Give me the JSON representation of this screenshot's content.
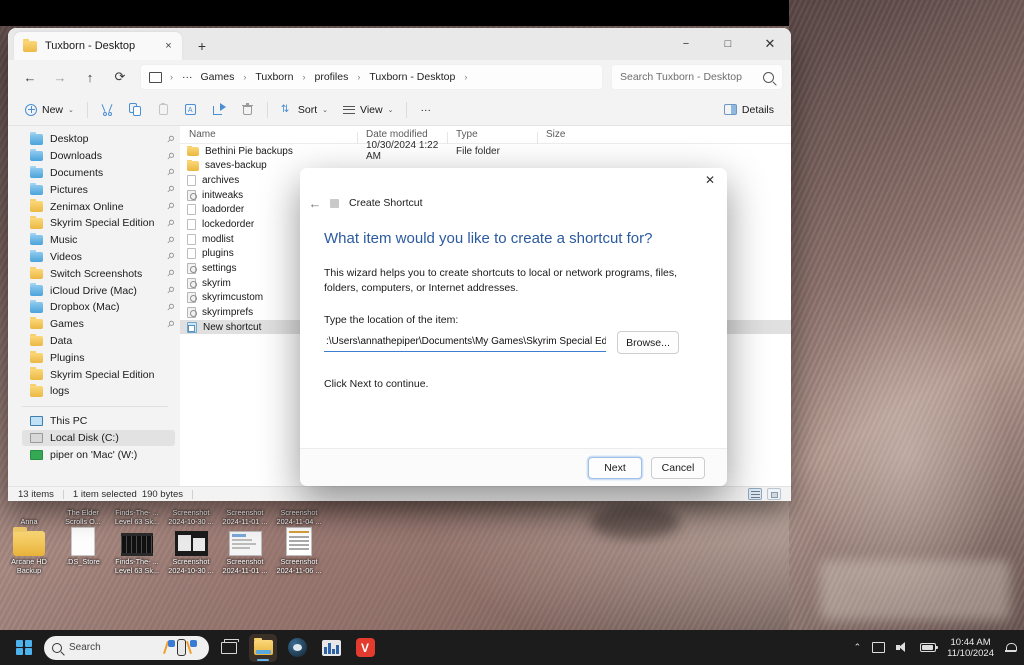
{
  "window": {
    "tab_title": "Tuxborn - Desktop",
    "tab_close_icon": "×",
    "new_tab_icon": "+",
    "minimize_icon": "−",
    "maximize_icon": "□",
    "close_icon": "✕"
  },
  "nav": {
    "back_icon": "←",
    "forward_icon": "→",
    "up_icon": "↑",
    "refresh_icon": "⟳"
  },
  "breadcrumb": {
    "overflow": "···",
    "separator": "›",
    "items": [
      {
        "label": "Games"
      },
      {
        "label": "Tuxborn"
      },
      {
        "label": "profiles"
      },
      {
        "label": "Tuxborn - Desktop"
      }
    ]
  },
  "search": {
    "placeholder": "Search Tuxborn - Desktop",
    "value": ""
  },
  "commandbar": {
    "new_label": "New",
    "cut_label": "Cut",
    "copy_label": "Copy",
    "paste_label": "Paste",
    "rename_label": "Rename",
    "share_label": "Share",
    "delete_label": "Delete",
    "sort_label": "Sort",
    "view_label": "View",
    "more_label": "···",
    "details_label": "Details",
    "chevron": "⌄"
  },
  "sidebar": {
    "pin_glyph": "📌",
    "quick_access": [
      {
        "label": "Desktop",
        "icon": "folder-blue",
        "pinned": true
      },
      {
        "label": "Downloads",
        "icon": "folder-blue",
        "pinned": true
      },
      {
        "label": "Documents",
        "icon": "folder-blue",
        "pinned": true
      },
      {
        "label": "Pictures",
        "icon": "folder-blue",
        "pinned": true
      },
      {
        "label": "Zenimax Online",
        "icon": "folder-yellow",
        "pinned": true
      },
      {
        "label": "Skyrim Special Edition",
        "icon": "folder-yellow",
        "pinned": true
      },
      {
        "label": "Music",
        "icon": "folder-blue",
        "pinned": true
      },
      {
        "label": "Videos",
        "icon": "folder-blue",
        "pinned": true
      },
      {
        "label": "Switch Screenshots",
        "icon": "folder-yellow",
        "pinned": true
      },
      {
        "label": "iCloud Drive (Mac)",
        "icon": "folder-blue",
        "pinned": true
      },
      {
        "label": "Dropbox (Mac)",
        "icon": "folder-blue",
        "pinned": true
      },
      {
        "label": "Games",
        "icon": "folder-yellow",
        "pinned": true
      },
      {
        "label": "Data",
        "icon": "folder-yellow",
        "pinned": false
      },
      {
        "label": "Plugins",
        "icon": "folder-yellow",
        "pinned": false
      },
      {
        "label": "Skyrim Special Edition",
        "icon": "folder-yellow",
        "pinned": false
      },
      {
        "label": "logs",
        "icon": "folder-yellow",
        "pinned": false
      }
    ],
    "this_pc": [
      {
        "label": "This PC",
        "icon": "pc",
        "selected": false
      },
      {
        "label": "Local Disk (C:)",
        "icon": "disk",
        "selected": true
      },
      {
        "label": "piper on 'Mac' (W:)",
        "icon": "network-drive",
        "selected": false
      }
    ]
  },
  "filelist": {
    "columns": [
      "Name",
      "Date modified",
      "Type",
      "Size"
    ],
    "sort_indicator": "⌃",
    "rows": [
      {
        "name": "Bethini Pie backups",
        "date": "10/30/2024 1:22 AM",
        "type": "File folder",
        "size": "",
        "icon": "folder",
        "selected": false
      },
      {
        "name": "saves-backup",
        "date": "",
        "type": "",
        "size": "",
        "icon": "folder",
        "selected": false
      },
      {
        "name": "archives",
        "date": "",
        "type": "",
        "size": "",
        "icon": "doc",
        "selected": false
      },
      {
        "name": "initweaks",
        "date": "",
        "type": "",
        "size": "",
        "icon": "config",
        "selected": false
      },
      {
        "name": "loadorder",
        "date": "",
        "type": "",
        "size": "",
        "icon": "doc",
        "selected": false
      },
      {
        "name": "lockedorder",
        "date": "",
        "type": "",
        "size": "",
        "icon": "doc",
        "selected": false
      },
      {
        "name": "modlist",
        "date": "",
        "type": "",
        "size": "",
        "icon": "doc",
        "selected": false
      },
      {
        "name": "plugins",
        "date": "",
        "type": "",
        "size": "",
        "icon": "doc",
        "selected": false
      },
      {
        "name": "settings",
        "date": "",
        "type": "",
        "size": "",
        "icon": "config",
        "selected": false
      },
      {
        "name": "skyrim",
        "date": "",
        "type": "",
        "size": "",
        "icon": "config",
        "selected": false
      },
      {
        "name": "skyrimcustom",
        "date": "",
        "type": "",
        "size": "",
        "icon": "config",
        "selected": false
      },
      {
        "name": "skyrimprefs",
        "date": "",
        "type": "",
        "size": "",
        "icon": "config",
        "selected": false
      },
      {
        "name": "New shortcut",
        "date": "",
        "type": "",
        "size": "",
        "icon": "shortcut",
        "selected": true
      }
    ]
  },
  "statusbar": {
    "item_count": "13 items",
    "selection": "1 item selected",
    "selection_size": "190 bytes",
    "details_view_icon": "details-view",
    "tiles_view_icon": "tiles-view"
  },
  "dialog": {
    "back_icon": "←",
    "close_icon": "✕",
    "title": "Create Shortcut",
    "heading": "What item would you like to create a shortcut for?",
    "description": "This wizard helps you to create shortcuts to local or network programs, files, folders, computers, or Internet addresses.",
    "field_label": "Type the location of the item:",
    "field_value": ":\\Users\\annathepiper\\Documents\\My Games\\Skyrim Special Edition\\Saves",
    "browse_label": "Browse...",
    "hint": "Click Next to continue.",
    "next_label": "Next",
    "cancel_label": "Cancel",
    "accent_color": "#2b5aa0"
  },
  "desktop": {
    "icons_row1": [
      {
        "label": "Anna",
        "icon": "folder"
      },
      {
        "label": "The Elder Scrolls O...",
        "icon": "document"
      },
      {
        "label": "Finds-The- ... Level 63 Sk...",
        "icon": "video"
      },
      {
        "label": "Screenshot 2024-10-30 ...",
        "icon": "screenshot"
      },
      {
        "label": "Screenshot 2024-11-01 ...",
        "icon": "screenshot"
      },
      {
        "label": "Screenshot 2024-11-04 ...",
        "icon": "screenshot"
      }
    ],
    "icons_row2": [
      {
        "label": "Arcane HD Backup",
        "icon": "folder"
      },
      {
        "label": ".DS_Store",
        "icon": "document"
      },
      {
        "label": "Finds-The- ... Level 63 Sk...",
        "icon": "video"
      },
      {
        "label": "Screenshot 2024-10-30 ...",
        "icon": "screenshot"
      },
      {
        "label": "Screenshot 2024-11-01 ...",
        "icon": "screenshot"
      },
      {
        "label": "Screenshot 2024-11-06 ...",
        "icon": "screenshot-sheet"
      }
    ]
  },
  "taskbar": {
    "start_label": "Start",
    "search_placeholder": "Search",
    "items": [
      {
        "name": "task-view",
        "label": "Task View"
      },
      {
        "name": "file-explorer",
        "label": "File Explorer",
        "active": true
      },
      {
        "name": "steam",
        "label": "Steam"
      },
      {
        "name": "monitor-app",
        "label": "Resource Monitor"
      },
      {
        "name": "vivaldi",
        "label": "Vivaldi",
        "glyph": "V"
      }
    ],
    "tray": {
      "overflow_icon": "⌃",
      "network_label": "Network",
      "volume_label": "Volume",
      "battery_label": "Battery",
      "time": "10:44 AM",
      "date": "11/10/2024",
      "notifications_label": "Notifications"
    }
  }
}
